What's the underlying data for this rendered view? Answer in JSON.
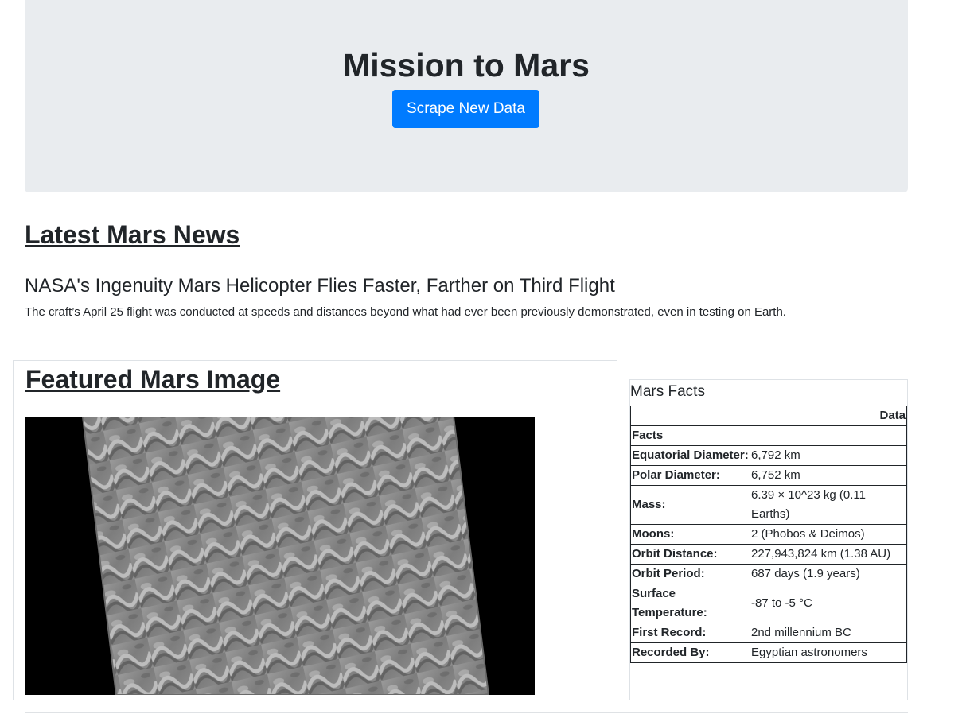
{
  "jumbotron": {
    "title": "Mission to Mars",
    "button_label": "Scrape New Data"
  },
  "news": {
    "heading": "Latest Mars News",
    "title": "NASA's Ingenuity Mars Helicopter Flies Faster, Farther on Third Flight",
    "paragraph": "The craft’s April 25 flight was conducted at speeds and distances beyond what had ever been previously demonstrated, even in testing on Earth."
  },
  "featured": {
    "heading": "Featured Mars Image"
  },
  "facts": {
    "caption": "Mars Facts",
    "header_value": "Data",
    "index_label": "Facts",
    "rows": [
      {
        "label": "Equatorial Diameter:",
        "value": "6,792 km"
      },
      {
        "label": "Polar Diameter:",
        "value": "6,752 km"
      },
      {
        "label": "Mass:",
        "value": "6.39 × 10^23 kg (0.11 Earths)"
      },
      {
        "label": "Moons:",
        "value": "2 (Phobos & Deimos)"
      },
      {
        "label": "Orbit Distance:",
        "value": "227,943,824 km (1.38 AU)"
      },
      {
        "label": "Orbit Period:",
        "value": "687 days (1.9 years)"
      },
      {
        "label": "Surface Temperature:",
        "value": "-87 to -5 °C"
      },
      {
        "label": "First Record:",
        "value": "2nd millennium BC"
      },
      {
        "label": "Recorded By:",
        "value": "Egyptian astronomers"
      }
    ]
  },
  "colors": {
    "primary": "#007bff",
    "jumbotron_bg": "#e9ecef",
    "text": "#212529"
  }
}
